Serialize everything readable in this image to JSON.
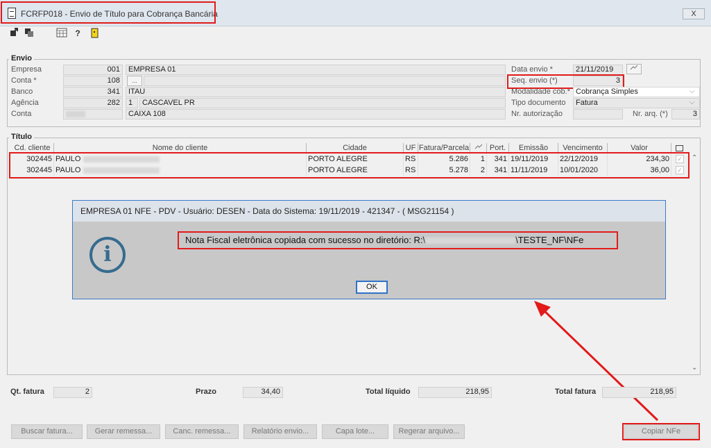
{
  "window": {
    "title": "FCRFP018 - Envio de Título para Cobrança Bancária",
    "close_label": "X"
  },
  "toolbar": {
    "icons": [
      "enter-icon",
      "exit-icon",
      "calendar-icon",
      "help-icon",
      "door-icon"
    ]
  },
  "envio": {
    "legend": "Envio",
    "empresa": {
      "label": "Empresa",
      "code": "001",
      "name": "EMPRESA 01"
    },
    "conta": {
      "label": "Conta *",
      "code": "108",
      "button": "..."
    },
    "banco": {
      "label": "Banco",
      "code": "341",
      "name": "ITAU"
    },
    "agencia": {
      "label": "Agência",
      "code": "282",
      "digit": "1",
      "name": "CASCAVEL PR"
    },
    "conta2": {
      "label": "Conta",
      "name": "CAIXA 108"
    },
    "data_envio": {
      "label": "Data envio *",
      "value": "21/11/2019"
    },
    "seq_envio": {
      "label": "Seq. envio (*)",
      "value": "3"
    },
    "modalidade": {
      "label": "Modalidade cob.*",
      "value": "Cobrança Simples"
    },
    "tipo_documento": {
      "label": "Tipo documento",
      "value": "Fatura"
    },
    "nr_autorizacao": {
      "label": "Nr. autorização",
      "value": ""
    },
    "nr_arq": {
      "label": "Nr. arq. (*)",
      "value": "3"
    }
  },
  "titulo": {
    "legend": "Título",
    "columns": [
      "Cd. cliente",
      "Nome do cliente",
      "Cidade",
      "UF",
      "Fatura/Parcela",
      "",
      "Port.",
      "Emissão",
      "Vencimento",
      "Valor"
    ],
    "rows": [
      {
        "cd": "302445",
        "nome": "PAULO",
        "cidade": "PORTO ALEGRE",
        "uf": "RS",
        "fatura": "5.286",
        "parcela": "1",
        "port": "341",
        "emissao": "19/11/2019",
        "vencimento": "22/12/2019",
        "valor": "234,30"
      },
      {
        "cd": "302445",
        "nome": "PAULO",
        "cidade": "PORTO ALEGRE",
        "uf": "RS",
        "fatura": "5.278",
        "parcela": "2",
        "port": "341",
        "emissao": "11/11/2019",
        "vencimento": "10/01/2020",
        "valor": "36,00"
      }
    ]
  },
  "dialog": {
    "title": "EMPRESA 01 NFE - PDV - Usuário: DESEN - Data do Sistema: 19/11/2019 - 421347 - ( MSG21154 )",
    "message_prefix": "Nota Fiscal eletrônica copiada com sucesso no diretório: R:\\",
    "message_suffix": "\\TESTE_NF\\NFe",
    "ok_label": "OK"
  },
  "totals": {
    "qt_fatura": {
      "label": "Qt. fatura",
      "value": "2"
    },
    "prazo": {
      "label": "Prazo",
      "value": "34,40"
    },
    "total_liquido": {
      "label": "Total líquido",
      "value": "218,95"
    },
    "total_fatura": {
      "label": "Total fatura",
      "value": "218,95"
    }
  },
  "buttons": {
    "buscar": "Buscar fatura...",
    "gerar": "Gerar remessa...",
    "canc": "Canc. remessa...",
    "relatorio": "Relatório envio...",
    "capa": "Capa lote...",
    "regerar": "Regerar arquivo...",
    "copiar": "Copiar NFe"
  },
  "highlight_color": "#e21a1a"
}
